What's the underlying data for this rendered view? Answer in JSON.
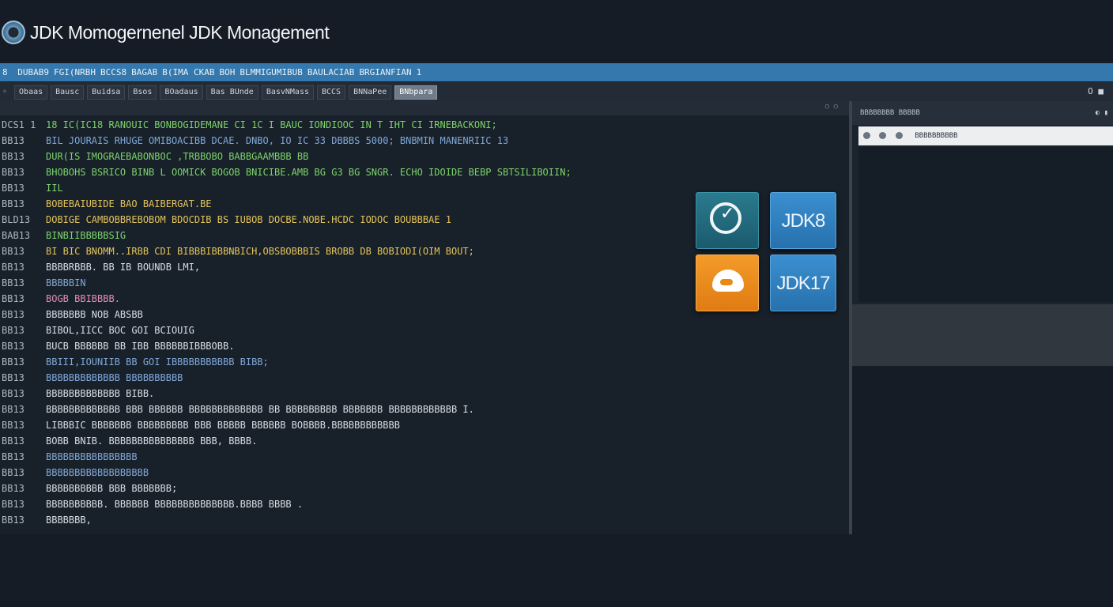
{
  "window": {
    "title": "JDK Momogernenel JDK Monagement"
  },
  "menubar": {
    "leading": "8",
    "items": [
      "DUBAB9",
      "FGI(NRBH",
      "BCCS8",
      "BAGAB",
      "B(IMA CKAB",
      "BOH",
      "BLMMIGUMIBUB",
      "BAULACIAB",
      "BRGIANFIAN",
      "1"
    ]
  },
  "toolbar": {
    "left_mark": "◦",
    "items": [
      {
        "label": "Obaas",
        "active": false
      },
      {
        "label": "Bausc",
        "active": false
      },
      {
        "label": "Buidsa",
        "active": false
      },
      {
        "label": "Bsos",
        "active": false
      },
      {
        "label": "BOadaus",
        "active": false
      },
      {
        "label": "Bas BUnde",
        "active": false
      },
      {
        "label": "BasvNMass",
        "active": false
      },
      {
        "label": "BCCS",
        "active": false
      },
      {
        "label": "BNNaPee",
        "active": false
      },
      {
        "label": "BNbpara",
        "active": true
      }
    ],
    "right_control": "O ■"
  },
  "editor": {
    "header_dots": "○ ○",
    "lines": [
      {
        "n": "DCS1 1",
        "t": "18 IC(IC18 RANOUIC  BONBOGIDEMANE CI 1C I BAUC IONDIOOC IN T IHT CI IRNEBACKONI;",
        "c": "#7dd36a"
      },
      {
        "n": "BB13",
        "t": "BIL  JOURAIS  RHUGE  OMIBOACIBB  DCAE.  DNBO,  IO  IC  33  DBBBS  5000;  BNBMIN MANENRIIC 13",
        "c": "#7fa8d6"
      },
      {
        "n": "BB13",
        "t": "DUR(IS  IMOGRAEBABONBOC  ,TRBBOBO  BABBGAAMBBB  BB",
        "c": "#7dd36a"
      },
      {
        "n": "BB13",
        "t": "BHOBOHS  BSRICO  BINB  L OOMICK  BOGOB  BNICIBE.AMB  BG  G3  BG  SNGR.  ECHO  IDOIDE  BEBP  SBTSILIBOIIN;",
        "c": "#7dd36a"
      },
      {
        "n": "BB13",
        "t": "IIL",
        "c": "#7dd36a"
      },
      {
        "n": "BB13",
        "t": "BOBEBAIUBIDE  BAO BAIBERGAT.BE",
        "c": "#e3c45a"
      },
      {
        "n": "BLD13",
        "t": "DOBIGE  CAMBOBBREBOBOM  BDOCDIB  BS  IUBOB  DOCBE.NOBE.HCDC  IODOC  BOUBBBAE  1",
        "c": "#e3c45a"
      },
      {
        "n": "BAB13",
        "t": "BINBIIBBBBBSIG",
        "c": "#7dd36a"
      },
      {
        "n": "BB13",
        "t": "BI  BIC  BNOMM..IRBB  CDI  BIBBBIBBBNBICH,OBSBOBBBIS BROBB  DB  BOBIODI(OIM  BOUT;",
        "c": "#e3c45a"
      },
      {
        "n": "BB13",
        "t": "BBBBRBBB.  BB  IB  BOUNDB  LMI,",
        "c": "#d9dee3"
      },
      {
        "n": "BB13",
        "t": "BBBBBIN",
        "c": "#7fa8d6"
      },
      {
        "n": "BB13",
        "t": "BOGB  BBIBBBB.",
        "c": "#e58bb6"
      },
      {
        "n": "BB13",
        "t": "BBBBBBB  NOB  ABSBB",
        "c": "#d9dee3"
      },
      {
        "n": "BB13",
        "t": "BIBOL,IICC  BOC  GOI  BCIOUIG",
        "c": "#d9dee3"
      },
      {
        "n": "BB13",
        "t": "BUCB BBBBBB  BB  IBB  BBBBBBIBBBOBB.",
        "c": "#d9dee3"
      },
      {
        "n": "BB13",
        "t": "BBIII,IOUNIIB  BB  GOI  IBBBBBBBBBBB  BIBB;",
        "c": "#7fa8d6"
      },
      {
        "n": "BB13",
        "t": "BBBBBBBBBBBBB  BBBBBBBBBB",
        "c": "#7fa8d6"
      },
      {
        "n": "BB13",
        "t": "BBBBBBBBBBBBB  BIBB.",
        "c": "#d9dee3"
      },
      {
        "n": "BB13",
        "t": "BBBBBBBBBBBBB  BBB  BBBBBB  BBBBBBBBBBBBB  BB BBBBBBBBB  BBBBBBB  BBBBBBBBBBBB  I.",
        "c": "#d9dee3"
      },
      {
        "n": "BB13",
        "t": "LIBBBIC  BBBBBBB  BBBBBBBBB  BBB  BBBBB  BBBBBB  BOBBBB.BBBBBBBBBBBB",
        "c": "#d9dee3"
      },
      {
        "n": "BB13",
        "t": "BOBB  BNIB.  BBBBBBBBBBBBBBB  BBB,  BBBB.",
        "c": "#d9dee3"
      },
      {
        "n": "BB13",
        "t": "BBBBBBBBBBBBBBBB",
        "c": "#7fa8d6"
      },
      {
        "n": "BB13",
        "t": "BBBBBBBBBBBBBBBBBB",
        "c": "#7fa8d6"
      },
      {
        "n": "BB13",
        "t": "BBBBBBBBBB  BBB  BBBBBBB;",
        "c": "#d9dee3"
      },
      {
        "n": "BB13",
        "t": "BBBBBBBBBB.  BBBBBB  BBBBBBBBBBBBBB.BBBB  BBBB  .",
        "c": "#d9dee3"
      },
      {
        "n": "BB13",
        "t": "BBBBBBB,",
        "c": "#d9dee3"
      }
    ]
  },
  "tiles": {
    "jdk8": "JDK8",
    "jdk17": "JDK17"
  },
  "right_panel": {
    "title": "BBBBBBBB  BBBBB",
    "dots": "◐ ▮",
    "field_value": "BBBBBBBBBB"
  }
}
